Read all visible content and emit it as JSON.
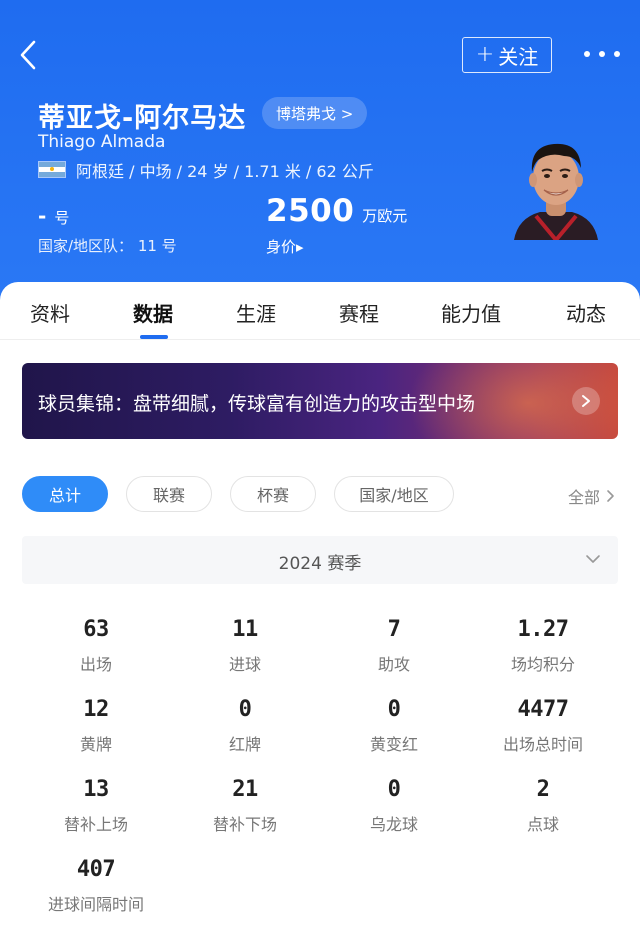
{
  "header": {
    "follow_label": "关注",
    "follow_plus": "+",
    "name_cn": "蒂亚戈-阿尔马达",
    "club": "博塔弗戈 >",
    "name_en": "Thiago Almada",
    "info": "阿根廷 / 中场 / 24 岁 / 1.71 米 / 62 公斤",
    "shirt_number": "-",
    "shirt_suffix": "号",
    "national_team": "国家/地区队：  11 号",
    "market_value": "2500",
    "market_value_unit": "万欧元",
    "market_value_label": "身价▸"
  },
  "tabs": [
    "资料",
    "数据",
    "生涯",
    "赛程",
    "能力值",
    "动态"
  ],
  "active_tab": "数据",
  "banner": {
    "text": "球员集锦：盘带细腻，传球富有创造力的攻击型中场"
  },
  "filters": {
    "items": [
      "总计",
      "联赛",
      "杯赛",
      "国家/地区"
    ],
    "all": "全部"
  },
  "season": "2024 赛季",
  "stats": [
    {
      "value": "63",
      "label": "出场"
    },
    {
      "value": "11",
      "label": "进球"
    },
    {
      "value": "7",
      "label": "助攻"
    },
    {
      "value": "1.27",
      "label": "场均积分"
    },
    {
      "value": "12",
      "label": "黄牌"
    },
    {
      "value": "0",
      "label": "红牌"
    },
    {
      "value": "0",
      "label": "黄变红"
    },
    {
      "value": "4477",
      "label": "出场总时间"
    },
    {
      "value": "13",
      "label": "替补上场"
    },
    {
      "value": "21",
      "label": "替补下场"
    },
    {
      "value": "0",
      "label": "乌龙球"
    },
    {
      "value": "2",
      "label": "点球"
    },
    {
      "value": "407",
      "label": "进球间隔时间"
    }
  ],
  "colors": {
    "header_blue": "#1f6cf0",
    "accent": "#2f8cf8"
  },
  "icons": [
    "back-arrow-icon",
    "more-dots-icon",
    "argentina-flag-icon",
    "chevron-right-icon",
    "chevron-down-icon"
  ]
}
